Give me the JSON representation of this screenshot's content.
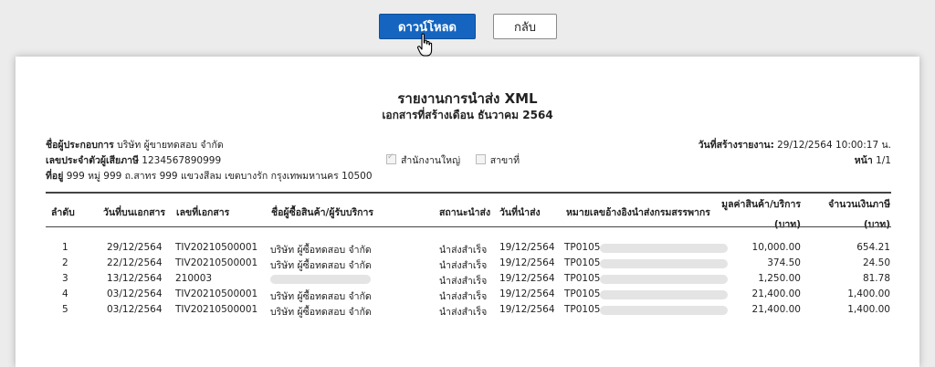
{
  "toolbar": {
    "download_label": "ดาวน์โหลด",
    "back_label": "กลับ"
  },
  "report": {
    "title": "รายงานการนำส่ง XML",
    "subtitle": "เอกสารที่สร้างเดือน ธันวาคม 2564",
    "operator_label": "ชื่อผู้ประกอบการ",
    "operator_value": "บริษัท ผู้ขายทดสอบ จำกัด",
    "taxid_label": "เลขประจำตัวผู้เสียภาษี",
    "taxid_value": "1234567890999",
    "address_label": "ที่อยู่",
    "address_value": "999 หมู่ 999 ถ.สาทร 999 แขวงสีลม เขตบางรัก กรุงเทพมหานคร 10500",
    "head_office_label": "สำนักงานใหญ่",
    "branch_label": "สาขาที่",
    "created_label": "วันที่สร้างรายงาน:",
    "created_value": "29/12/2564 10:00:17 น.",
    "page_label": "หน้า",
    "page_value": "1/1"
  },
  "table": {
    "headers": {
      "seq": "ลำดับ",
      "doc_date": "วันที่บนเอกสาร",
      "doc_no": "เลขที่เอกสาร",
      "buyer_l1": "ชื่อผู้ซื้อสินค้า/ผู้รับบริการ",
      "status": "สถานะนำส่ง",
      "sent_date": "วันที่นำส่ง",
      "ref": "หมายเลขอ้างอิงนำส่งกรมสรรพากร",
      "amount_l1": "มูลค่าสินค้า/บริการ",
      "amount_l2": "(บาท)",
      "tax_l1": "จำนวนเงินภาษี",
      "tax_l2": "(บาท)"
    },
    "rows": [
      {
        "seq": "1",
        "doc_date": "29/12/2564",
        "doc_no": "TIV20210500001",
        "buyer": "บริษัท ผู้ซื้อทดสอบ จำกัด",
        "status": "นำส่งสำเร็จ",
        "sent_date": "19/12/2564",
        "ref": "TP0105",
        "amount": "10,000.00",
        "tax": "654.21"
      },
      {
        "seq": "2",
        "doc_date": "22/12/2564",
        "doc_no": "TIV20210500001",
        "buyer": "บริษัท ผู้ซื้อทดสอบ จำกัด",
        "status": "นำส่งสำเร็จ",
        "sent_date": "19/12/2564",
        "ref": "TP0105",
        "amount": "374.50",
        "tax": "24.50"
      },
      {
        "seq": "3",
        "doc_date": "13/12/2564",
        "doc_no": "210003",
        "buyer": "",
        "status": "นำส่งสำเร็จ",
        "sent_date": "19/12/2564",
        "ref": "TP0105",
        "amount": "1,250.00",
        "tax": "81.78"
      },
      {
        "seq": "4",
        "doc_date": "03/12/2564",
        "doc_no": "TIV20210500001",
        "buyer": "บริษัท ผู้ซื้อทดสอบ จำกัด",
        "status": "นำส่งสำเร็จ",
        "sent_date": "19/12/2564",
        "ref": "TP0105",
        "amount": "21,400.00",
        "tax": "1,400.00"
      },
      {
        "seq": "5",
        "doc_date": "03/12/2564",
        "doc_no": "TIV20210500001",
        "buyer": "บริษัท ผู้ซื้อทดสอบ จำกัด",
        "status": "นำส่งสำเร็จ",
        "sent_date": "19/12/2564",
        "ref": "TP0105",
        "amount": "21,400.00",
        "tax": "1,400.00"
      }
    ]
  }
}
